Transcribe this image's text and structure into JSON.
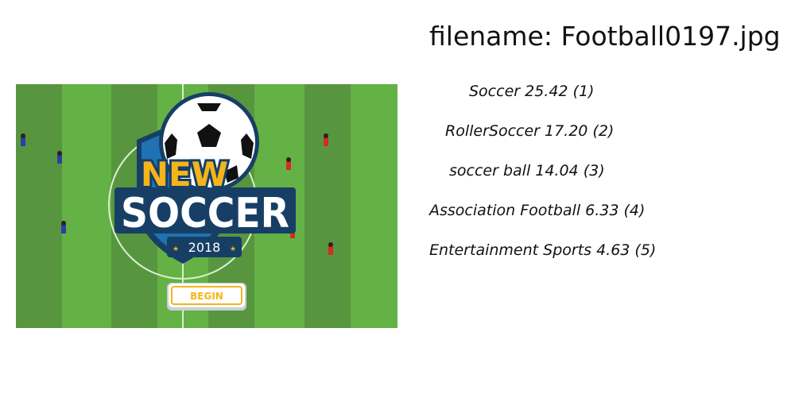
{
  "title": "filename: Football0197.jpg",
  "labels": [
    "Soccer 25.42 (1)",
    "RollerSoccer 17.20 (2)",
    "soccer ball 14.04 (3)",
    "Association Football  6.33 (4)",
    "Entertainment Sports  4.63 (5)"
  ],
  "image": {
    "logo_new": "NEW",
    "logo_soccer": "SOCCER",
    "logo_year": "2018",
    "begin_label": "BEGIN"
  },
  "colors": {
    "field_light": "#64b146",
    "field_dark": "#57963f",
    "shield_blue": "#1f72b3",
    "shield_navy": "#173f66",
    "logo_yellow": "#f5b41a",
    "team_blue": "#2a3fa8",
    "team_red": "#d62b22"
  }
}
